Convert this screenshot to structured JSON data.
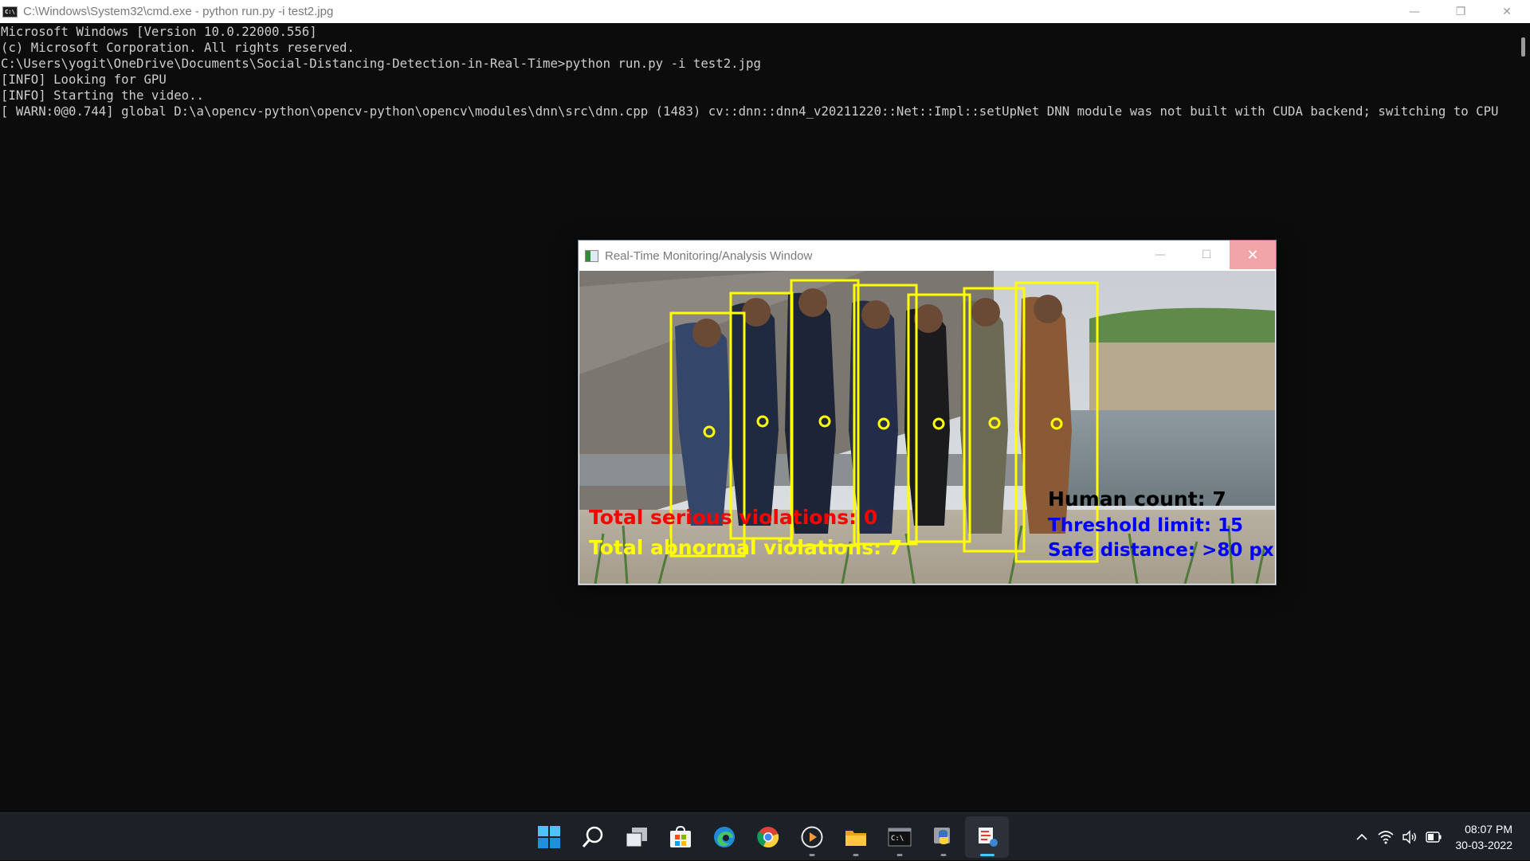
{
  "cmd_window": {
    "title": "C:\\Windows\\System32\\cmd.exe - python  run.py -i test2.jpg",
    "app_icon_text": "C:\\",
    "controls": {
      "minimize": "—",
      "restore": "❐",
      "close": "✕"
    },
    "lines": [
      "Microsoft Windows [Version 10.0.22000.556]",
      "(c) Microsoft Corporation. All rights reserved.",
      "",
      "C:\\Users\\yogit\\OneDrive\\Documents\\Social-Distancing-Detection-in-Real-Time>python run.py -i test2.jpg",
      "",
      "[INFO] Looking for GPU",
      "[INFO] Starting the video..",
      "[ WARN:0@0.744] global D:\\a\\opencv-python\\opencv-python\\opencv\\modules\\dnn\\src\\dnn.cpp (1483) cv::dnn::dnn4_v20211220::Net::Impl::setUpNet DNN module was not built with CUDA backend; switching to CPU"
    ]
  },
  "analysis_window": {
    "title": "Real-Time Monitoring/Analysis Window",
    "controls": {
      "minimize": "—",
      "maximize": "☐",
      "close": "✕"
    },
    "overlay": {
      "serious": "Total serious violations: 0",
      "abnormal": "Total abnormal violations: 7",
      "human_count": "Human count: 7",
      "threshold": "Threshold limit: 15",
      "safe_distance": "Safe distance: >80 px"
    },
    "colors": {
      "box": "#ffff00",
      "serious": "#ff0000",
      "abnormal": "#ffff00",
      "human_count": "#000000",
      "threshold": "#0000ff",
      "safe_distance": "#0000ff"
    }
  },
  "taskbar": {
    "apps": [
      {
        "name": "start",
        "icon": "windows-logo-icon"
      },
      {
        "name": "search",
        "icon": "search-icon"
      },
      {
        "name": "task-view",
        "icon": "task-view-icon"
      },
      {
        "name": "store",
        "icon": "store-icon"
      },
      {
        "name": "edge",
        "icon": "edge-icon"
      },
      {
        "name": "chrome",
        "icon": "chrome-icon"
      },
      {
        "name": "media-player",
        "icon": "play-icon"
      },
      {
        "name": "file-explorer",
        "icon": "folder-icon"
      },
      {
        "name": "terminal",
        "icon": "terminal-icon"
      },
      {
        "name": "python",
        "icon": "python-icon"
      },
      {
        "name": "analysis-window",
        "icon": "analysis-window-icon"
      }
    ],
    "clock": {
      "time": "08:07 PM",
      "date": "30-03-2022"
    },
    "tray_icons": [
      "chevron-up-icon",
      "wifi-icon",
      "volume-icon",
      "battery-icon"
    ]
  }
}
